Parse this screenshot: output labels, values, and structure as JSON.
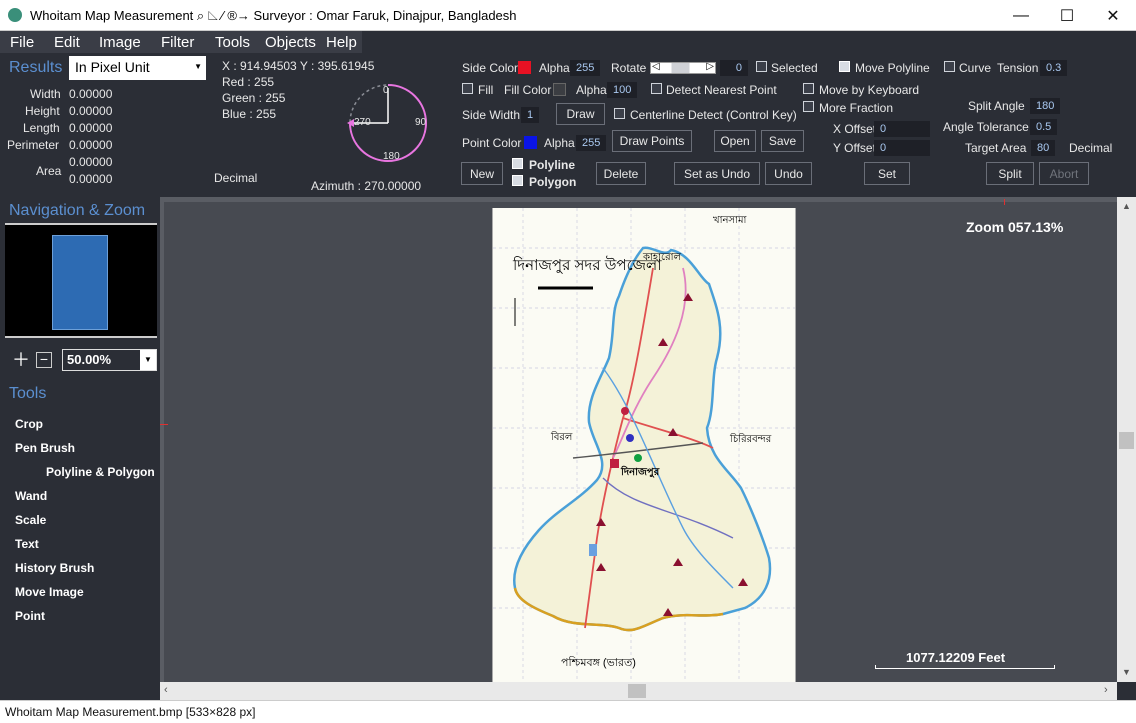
{
  "titlebar": {
    "title": "Whoitam Map Measurement ⌕ ◺ ∕ ®→ Surveyor : Omar Faruk, Dinajpur, Bangladesh",
    "minimize": "—",
    "maximize": "☐",
    "close": "✕"
  },
  "menu": [
    "File",
    "Edit",
    "Image",
    "Filter",
    "Tools",
    "Objects",
    "Help"
  ],
  "results": {
    "heading": "Results",
    "unit_select": "In Pixel Unit",
    "rows": [
      {
        "label": "Width",
        "value": "0.00000"
      },
      {
        "label": "Height",
        "value": "0.00000"
      },
      {
        "label": "Length",
        "value": "0.00000"
      },
      {
        "label": "Perimeter",
        "value": "0.00000"
      },
      {
        "label": "Area",
        "value": "0.00000"
      },
      {
        "label": "",
        "value": "0.00000"
      }
    ]
  },
  "pixel": {
    "xy": "X : 914.94503  Y : 395.61945",
    "red": "Red : 255",
    "green": "Green : 255",
    "blue": "Blue : 255",
    "decimal": "Decimal"
  },
  "dial": {
    "top": "0",
    "right": "90",
    "bottom": "180",
    "left": "270",
    "azimuth": "Azimuth : 270.00000"
  },
  "controls": {
    "side_color": "Side Color",
    "alpha1_label": "Alpha",
    "alpha1_value": "255",
    "rotate_label": "Rotate",
    "rotate_value": "0",
    "selected": "Selected",
    "move_polyline": "Move Polyline",
    "curve": "Curve",
    "tension_label": "Tension",
    "tension_value": "0.3",
    "fill": "Fill",
    "fill_color": "Fill Color",
    "alpha2_label": "Alpha",
    "alpha2_value": "100",
    "detect_nearest": "Detect Nearest Point",
    "move_keyboard": "Move by Keyboard",
    "more_fraction": "More Fraction",
    "side_width_label": "Side Width",
    "side_width_value": "1",
    "draw": "Draw",
    "centerline": "Centerline Detect (Control Key)",
    "split_angle_label": "Split Angle",
    "split_angle_value": "180",
    "x_offset_label": "X Offset",
    "x_offset_value": "0",
    "angle_tol_label": "Angle Tolerance",
    "angle_tol_value": "0.5",
    "point_color": "Point Color",
    "alpha3_label": "Alpha",
    "alpha3_value": "255",
    "draw_points": "Draw Points",
    "open": "Open",
    "save": "Save",
    "y_offset_label": "Y Offset",
    "y_offset_value": "0",
    "target_area_label": "Target Area",
    "target_area_value": "80",
    "decimal": "Decimal",
    "new": "New",
    "polyline": "Polyline",
    "polygon": "Polygon",
    "delete": "Delete",
    "set_as_undo": "Set as Undo",
    "undo": "Undo",
    "set": "Set",
    "split": "Split",
    "abort": "Abort"
  },
  "colors": {
    "side": "#e81123",
    "fill": "#3b3d42",
    "point": "#0a14e6"
  },
  "nav": {
    "heading": "Navigation & Zoom",
    "zoom_value": "50.00%"
  },
  "tools": {
    "heading": "Tools",
    "items": [
      "Crop",
      "Pen Brush",
      "Polyline & Polygon",
      "Wand",
      "Scale",
      "Text",
      "History Brush",
      "Move Image",
      "Point"
    ]
  },
  "canvas": {
    "zoom": "Zoom 057.13%",
    "scale": "1077.12209 Feet"
  },
  "map": {
    "title": "দিনাজপুর সদর উপজেলা",
    "kaharol": "কাহারোল",
    "khansama": "খানসামা",
    "biral": "বিরল",
    "chirirbandar": "চিরিরবন্দর",
    "dinajpur": "দিনাজপুর",
    "bengal": "পশ্চিমবঙ্গ (ভারত)"
  },
  "status": "Whoitam Map Measurement.bmp  [533×828 px]"
}
